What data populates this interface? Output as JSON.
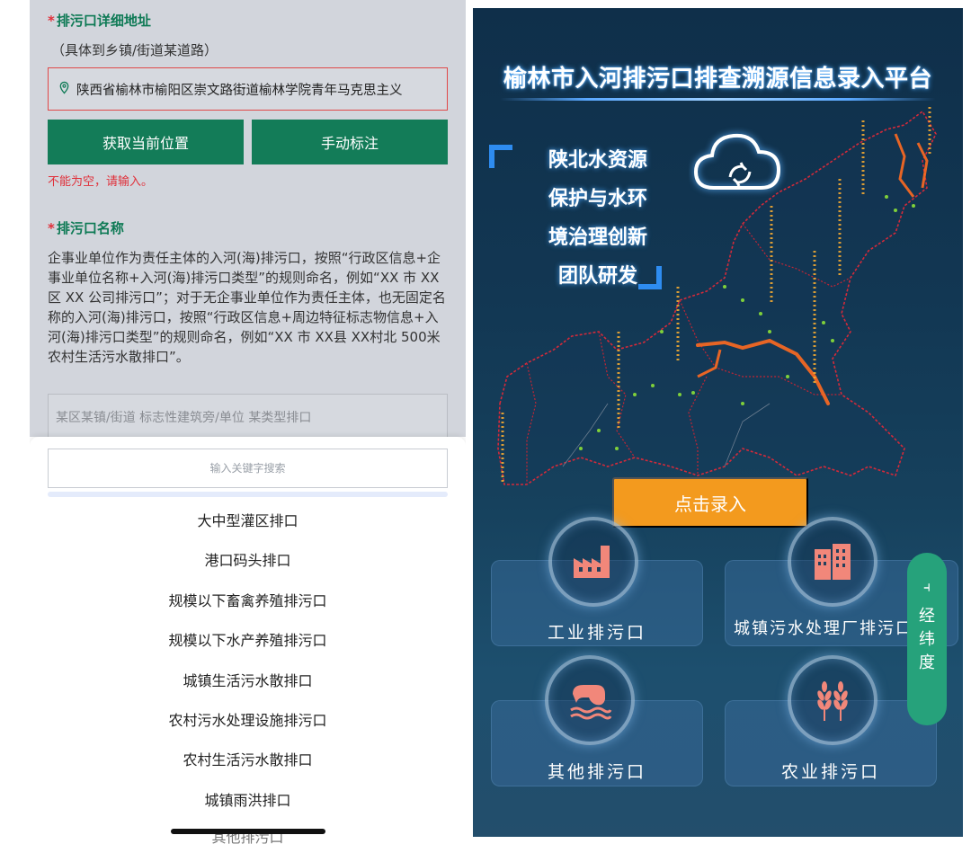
{
  "left": {
    "address_label": "排污口详细地址",
    "address_hint": "（具体到乡镇/街道某道路）",
    "address_value": "陕西省榆林市榆阳区崇文路街道榆林学院青年马克思主义",
    "get_location_btn": "获取当前位置",
    "manual_mark_btn": "手动标注",
    "error_text": "不能为空，请输入。",
    "name_label": "排污口名称",
    "name_desc": "企事业单位作为责任主体的入河(海)排污口，按照“行政区信息+企事业单位名称+入河(海)排污口类型”的规则命名，例如“XX 市 XX 区 XX 公司排污口”；对于无企事业单位作为责任主体，也无固定名称的入河(海)排污口，按照“行政区信息+周边特征标志物信息+入河(海)排污口类型”的规则命名，例如“XX 市 XX县 XX村北 500米农村生活污水散排口”。",
    "name_placeholder": "某区某镇/街道 标志性建筑旁/单位  某类型排口",
    "search_placeholder": "输入关键字搜索",
    "options": [
      "大中型灌区排口",
      "港口码头排口",
      "规模以下畜禽养殖排污口",
      "规模以下水产养殖排污口",
      "城镇生活污水散排口",
      "农村污水处理设施排污口",
      "农村生活污水散排口",
      "城镇雨洪排口",
      "其他排污口"
    ]
  },
  "right": {
    "title": "榆林市入河排污口排查溯源信息录入平台",
    "team_lines": [
      "陕北水资源",
      "保护与水环",
      "境治理创新",
      "团队研发"
    ],
    "enter_btn": "点击录入",
    "cards": {
      "industrial": "工业排污口",
      "urban_plant": "城镇污水处理厂排污口",
      "other": "其他排污口",
      "agri": "农业排污口"
    },
    "side_pill": {
      "icon": "pointer-icon",
      "chars": [
        "经",
        "纬",
        "度"
      ]
    }
  },
  "colors": {
    "green": "#137c58",
    "error_red": "#e0303a",
    "orange": "#f39a1e",
    "navy": "#123753",
    "pill_green": "#26a27b"
  }
}
